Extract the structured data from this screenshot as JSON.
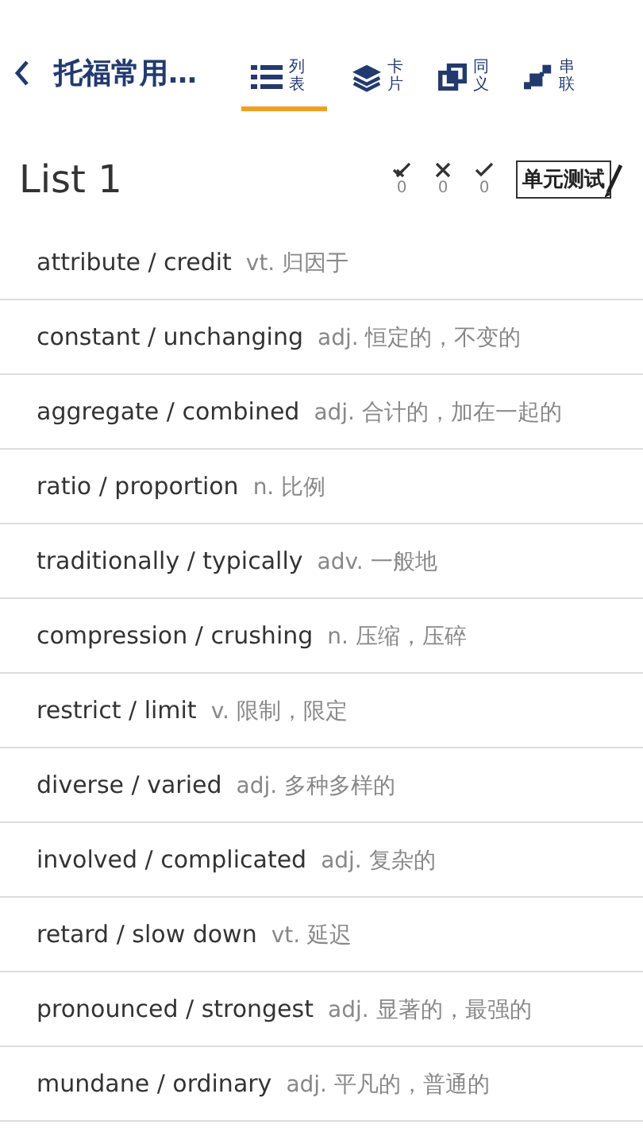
{
  "header": {
    "title": "托福常用…"
  },
  "tabs": [
    {
      "label": "列表",
      "selected": true
    },
    {
      "label": "卡片",
      "selected": false
    },
    {
      "label": "同义",
      "selected": false
    },
    {
      "label": "串联",
      "selected": false
    }
  ],
  "list_title": "List 1",
  "stats": [
    {
      "count": "0"
    },
    {
      "count": "0"
    },
    {
      "count": "0"
    }
  ],
  "test_button": "单元测试",
  "words": [
    {
      "term": "attribute / credit",
      "meaning": "vt. 归因于"
    },
    {
      "term": "constant / unchanging",
      "meaning": "adj. 恒定的，不变的"
    },
    {
      "term": "aggregate / combined",
      "meaning": "adj. 合计的，加在一起的"
    },
    {
      "term": "ratio / proportion",
      "meaning": "n. 比例"
    },
    {
      "term": "traditionally / typically",
      "meaning": "adv. 一般地"
    },
    {
      "term": "compression / crushing",
      "meaning": "n. 压缩，压碎"
    },
    {
      "term": "restrict / limit",
      "meaning": "v. 限制，限定"
    },
    {
      "term": "diverse / varied",
      "meaning": "adj. 多种多样的"
    },
    {
      "term": "involved / complicated",
      "meaning": "adj. 复杂的"
    },
    {
      "term": "retard / slow down",
      "meaning": "vt. 延迟"
    },
    {
      "term": "pronounced / strongest",
      "meaning": "adj. 显著的，最强的"
    },
    {
      "term": "mundane / ordinary",
      "meaning": "adj. 平凡的，普通的"
    }
  ]
}
